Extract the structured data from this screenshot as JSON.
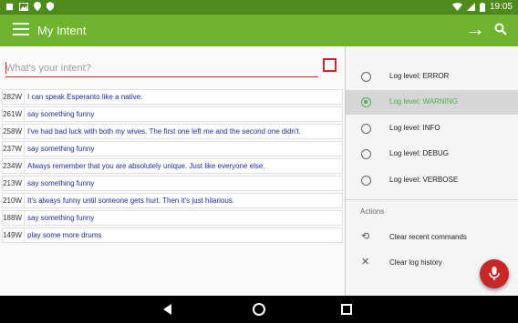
{
  "status_bar": {
    "time": "19:05",
    "left_icons": [
      "notification-icon",
      "image-icon",
      "location-icon",
      "shield-icon"
    ],
    "right_icons": [
      "wifi-icon",
      "signal-icon",
      "battery-icon"
    ]
  },
  "app_bar": {
    "title": "My Intent"
  },
  "search": {
    "placeholder": "What's your intent?",
    "value": ""
  },
  "history": [
    {
      "count": "282W",
      "text": "I can speak Esperanto like a native."
    },
    {
      "count": "261W",
      "text": "say something funny"
    },
    {
      "count": "258W",
      "text": "I've had bad luck with both my wives. The first one left me and the second one didn't."
    },
    {
      "count": "237W",
      "text": "say something funny"
    },
    {
      "count": "234W",
      "text": "Always remember that you are absolutely unique. Just like everyone else."
    },
    {
      "count": "213W",
      "text": "say something funny"
    },
    {
      "count": "210W",
      "text": "It's always funny until someone gets hurt. Then it's just hilarious."
    },
    {
      "count": "188W",
      "text": "say something funny"
    },
    {
      "count": "149W",
      "text": "play some more drums"
    }
  ],
  "drawer": {
    "log_levels": [
      {
        "label": "Log level: ERROR",
        "selected": false
      },
      {
        "label": "Log level: WARNING",
        "selected": true
      },
      {
        "label": "Log level: INFO",
        "selected": false
      },
      {
        "label": "Log level: DEBUG",
        "selected": false
      },
      {
        "label": "Log level: VERBOSE",
        "selected": false
      }
    ],
    "actions_heading": "Actions",
    "actions": [
      {
        "label": "Clear recent commands",
        "icon": "history-search-icon"
      },
      {
        "label": "Clear log history",
        "icon": "close-icon"
      }
    ]
  },
  "colors": {
    "app_bar": "#6fb32e",
    "status_bar": "#4f8b1c",
    "accent": "#c62828",
    "selected": "#4caf50"
  }
}
